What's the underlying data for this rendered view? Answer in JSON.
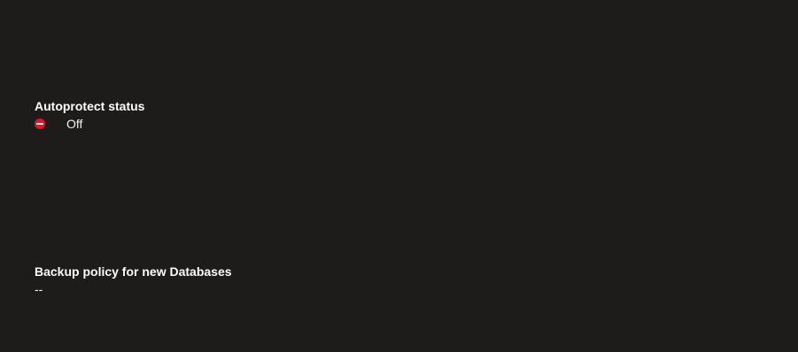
{
  "autoprotect": {
    "label": "Autoprotect status",
    "status_icon": "blocked-status-icon",
    "status_color": "#e81123",
    "status_text": "Off"
  },
  "backup_policy": {
    "label": "Backup policy for new Databases",
    "value": "--"
  }
}
